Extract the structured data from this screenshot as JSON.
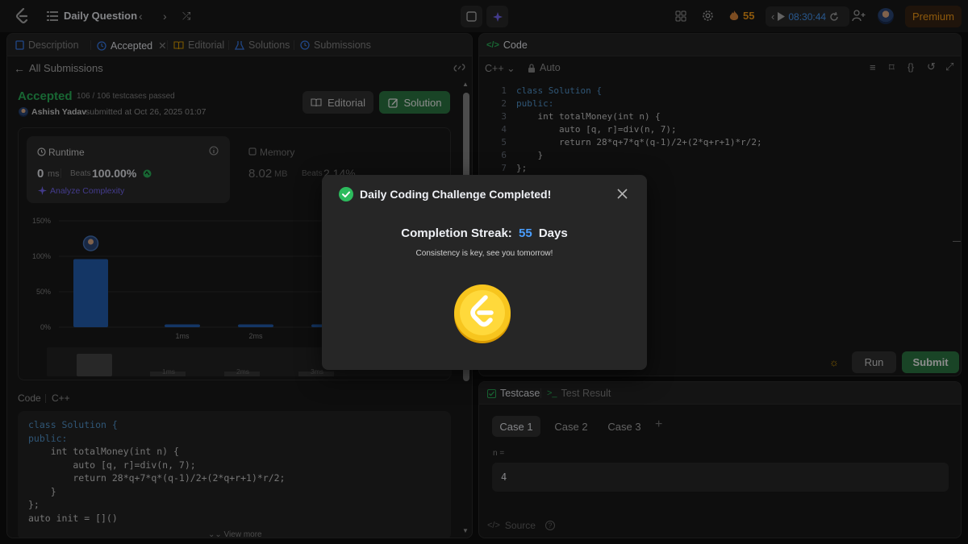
{
  "topbar": {
    "title": "Daily Question",
    "streak": "55",
    "timer": "08:30:44",
    "premium": "Premium"
  },
  "left": {
    "tabs": {
      "description": "Description",
      "accepted": "Accepted",
      "editorial": "Editorial",
      "solutions": "Solutions",
      "submissions": "Submissions"
    },
    "back": "All Submissions",
    "status": "Accepted",
    "testcases": "106 / 106 testcases passed",
    "user": "Ashish Yadav",
    "submitted": "submitted at Oct 26, 2025 01:07",
    "editorial_btn": "Editorial",
    "solution_btn": "Solution",
    "runtime": {
      "label": "Runtime",
      "value": "0",
      "unit": "ms",
      "beats_label": "Beats",
      "beats": "100.00%",
      "analyze": "Analyze Complexity"
    },
    "memory": {
      "label": "Memory",
      "value": "8.02",
      "unit": "MB",
      "beats_label": "Beats",
      "beats": "2.14%"
    },
    "chart_data": {
      "type": "bar",
      "categories": [
        "",
        "1ms",
        "2ms",
        "3ms"
      ],
      "values": [
        96,
        4,
        4,
        4
      ],
      "yticks": [
        "150%",
        "100%",
        "50%",
        "0%"
      ],
      "ylim": [
        0,
        150
      ]
    },
    "mini_ticks": [
      "1ms",
      "2ms",
      "3ms"
    ],
    "code_label": "Code",
    "code_lang": "C++",
    "code": [
      "class Solution {",
      "public:",
      "    int totalMoney(int n) {",
      "        auto [q, r]=div(n, 7);",
      "        return 28*q+7*q*(q-1)/2+(2*q+r+1)*r/2;",
      "    }",
      "};",
      "auto init = []()"
    ],
    "view_more": "View more"
  },
  "right": {
    "code_tab": "Code",
    "lang": "C++",
    "mode": "Auto",
    "line_numbers": [
      "1",
      "2",
      "3",
      "4",
      "5",
      "6",
      "7",
      "8",
      "9",
      "10"
    ],
    "code": [
      "class Solution {",
      "public:",
      "    int totalMoney(int n) {",
      "        auto [q, r]=div(n, 7);",
      "        return 28*q+7*q*(q-1)/2+(2*q+r+1)*r/2;",
      "    }",
      "};",
      "auto init = []()",
      "",
      ""
    ],
    "run": "Run",
    "submit": "Submit",
    "testcase_tab": "Testcase",
    "result_tab": "Test Result",
    "cases": [
      "Case 1",
      "Case 2",
      "Case 3"
    ],
    "input_label": "n =",
    "input_value": "4",
    "source": "Source"
  },
  "modal": {
    "title": "Daily Coding Challenge Completed!",
    "streak_label": "Completion Streak:",
    "streak_value": "55",
    "streak_unit": "Days",
    "subtitle": "Consistency is key, see you tomorrow!"
  },
  "colors": {
    "accent": "#ffa116",
    "green": "#2cbb5d",
    "blue": "#4a9eff",
    "submit_green": "#2f7d46"
  }
}
